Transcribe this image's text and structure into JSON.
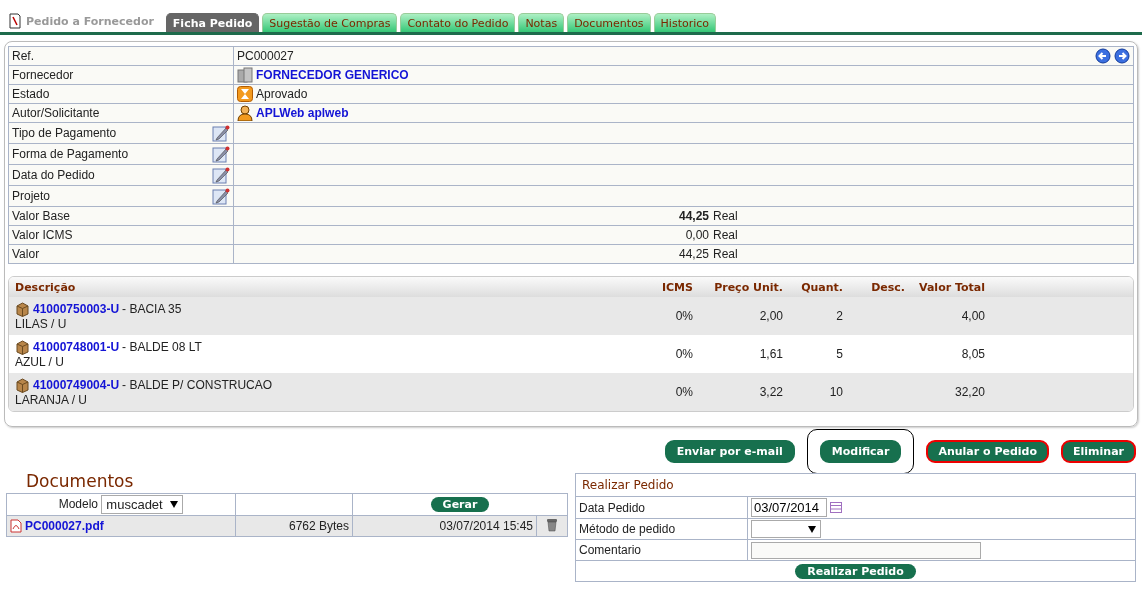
{
  "page_title": "Pedido a Fornecedor",
  "tabs": [
    {
      "label": "Ficha Pedido",
      "selected": true
    },
    {
      "label": "Sugestão de Compras",
      "selected": false
    },
    {
      "label": "Contato do Pedido",
      "selected": false
    },
    {
      "label": "Notas",
      "selected": false
    },
    {
      "label": "Documentos",
      "selected": false
    },
    {
      "label": "Historico",
      "selected": false
    }
  ],
  "fields": [
    {
      "label": "Ref.",
      "kind": "plain",
      "value": "PC000027"
    },
    {
      "label": "Fornecedor",
      "kind": "supplier",
      "value": "FORNECEDOR GENERICO"
    },
    {
      "label": "Estado",
      "kind": "status",
      "value": "Aprovado"
    },
    {
      "label": "Autor/Solicitante",
      "kind": "author",
      "value": "APLWeb aplweb"
    },
    {
      "label": "Tipo de Pagamento",
      "kind": "editable"
    },
    {
      "label": "Forma de Pagamento",
      "kind": "editable"
    },
    {
      "label": "Data do Pedido",
      "kind": "editable"
    },
    {
      "label": "Projeto",
      "kind": "editable"
    },
    {
      "label": "Valor Base",
      "kind": "amount",
      "value": "44,25",
      "currency": "Real",
      "bold": true
    },
    {
      "label": "Valor ICMS",
      "kind": "amount",
      "value": "0,00",
      "currency": "Real",
      "bold": false
    },
    {
      "label": "Valor",
      "kind": "amount",
      "value": "44,25",
      "currency": "Real",
      "bold": false
    }
  ],
  "lines": {
    "columns": [
      "Descrição",
      "ICMS",
      "Preço Unit.",
      "Quant.",
      "Desc.",
      "Valor Total"
    ],
    "rows": [
      {
        "code": "41000750003-U",
        "name": "- BACIA 35",
        "variant": "LILAS / U",
        "icms": "0%",
        "price": "2,00",
        "qty": "2",
        "total": "4,00"
      },
      {
        "code": "41000748001-U",
        "name": "- BALDE 08 LT",
        "variant": "AZUL / U",
        "icms": "0%",
        "price": "1,61",
        "qty": "5",
        "total": "8,05"
      },
      {
        "code": "41000749004-U",
        "name": "- BALDE P/ CONSTRUCAO",
        "variant": "LARANJA / U",
        "icms": "0%",
        "price": "3,22",
        "qty": "10",
        "total": "32,20"
      }
    ]
  },
  "actions": [
    {
      "label": "Enviar por e-mail",
      "kind": "normal",
      "focused": false
    },
    {
      "label": "Modificar",
      "kind": "normal",
      "focused": true
    },
    {
      "label": "Anular o Pedido",
      "kind": "danger",
      "focused": false
    },
    {
      "label": "Eliminar",
      "kind": "danger",
      "focused": false
    }
  ],
  "documents": {
    "title": "Documentos",
    "model_label": "Modelo",
    "model_value": "muscadet",
    "generate": "Gerar",
    "files": [
      {
        "name": "PC000027.pdf",
        "size": "6762 Bytes",
        "date": "03/07/2014 15:45"
      }
    ]
  },
  "place_order": {
    "title": "Realizar Pedido",
    "date_label": "Data Pedido",
    "date_value": "03/07/2014",
    "method_label": "Método de pedido",
    "comment_label": "Comentario",
    "button": "Realizar Pedido"
  }
}
